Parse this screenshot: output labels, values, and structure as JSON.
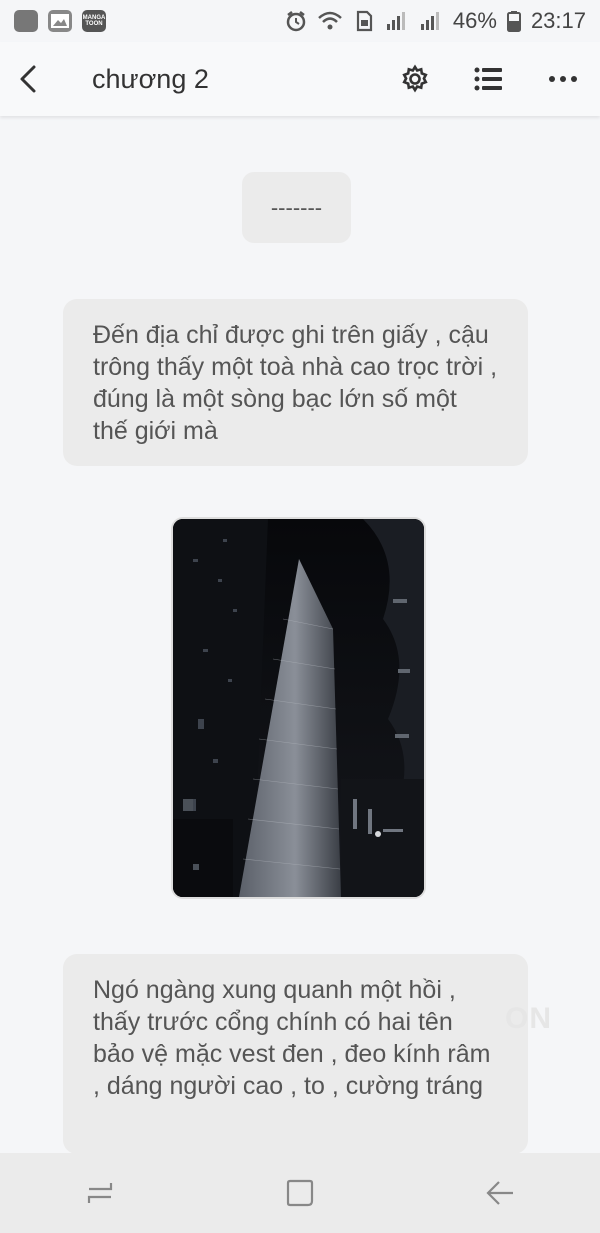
{
  "status_bar": {
    "battery_percent": "46%",
    "time": "23:17",
    "notification_icons": [
      "app-icon",
      "gallery-icon",
      "mangatoon-icon"
    ],
    "manga_icon_text": "MANGA TOON",
    "system_icons": [
      "alarm-icon",
      "wifi-icon",
      "sim-icon",
      "signal-icon",
      "signal-icon",
      "battery-icon"
    ]
  },
  "app_bar": {
    "title": "chương 2",
    "icons": [
      "back-icon",
      "settings-icon",
      "list-icon",
      "more-icon"
    ]
  },
  "content": {
    "divider_text": "-------",
    "paragraph_1": "Đến địa chỉ được ghi trên giấy , cậu trông thấy một toà nhà cao trọc trời , đúng là một sòng bạc lớn số một thế giới mà",
    "image_alt": "night-skyscraper-image",
    "paragraph_2": "Ngó ngàng xung quanh một hồi , thấy trước cổng chính có hai tên bảo vệ mặc vest đen , đeo kính râm , dáng người cao , to , cường tráng",
    "watermark_text": "ON"
  },
  "nav_bar": {
    "icons": [
      "recent-apps-icon",
      "home-icon",
      "back-nav-icon"
    ]
  }
}
